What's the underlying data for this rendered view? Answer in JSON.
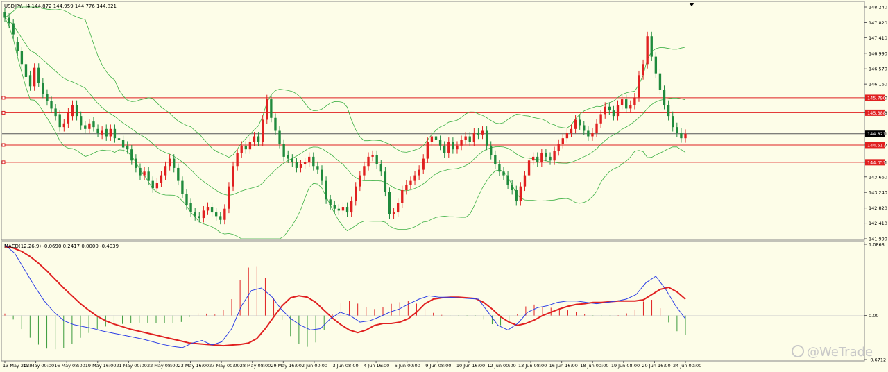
{
  "chart_data": [
    {
      "type": "candlestick",
      "title": "USDJPY,H4  144.872 144.959 144.776 144.821",
      "ylim": [
        141.99,
        148.24
      ],
      "y_ticks": [
        "148.240",
        "147.820",
        "147.410",
        "146.990",
        "146.570",
        "146.160",
        "145.790",
        "145.388",
        "144.821",
        "144.517",
        "144.051",
        "143.660",
        "143.240",
        "142.820",
        "142.410",
        "141.990"
      ],
      "current_price": "144.821",
      "horizontal_levels": [
        {
          "value": 145.79,
          "label": "145.790",
          "color": "#e02020"
        },
        {
          "value": 145.388,
          "label": "145.388",
          "color": "#e02020"
        },
        {
          "value": 144.517,
          "label": "144.517",
          "color": "#e02020"
        },
        {
          "value": 144.051,
          "label": "144.051",
          "color": "#e02020"
        }
      ],
      "indicators": [
        "Bollinger Bands"
      ],
      "colors": {
        "up": "#e02020",
        "down": "#1f8a3c",
        "bands": "#3cb043",
        "level": "#e02020",
        "price_line": "#555555"
      },
      "close": [
        147.95,
        147.8,
        147.5,
        147.05,
        146.7,
        146.35,
        146.1,
        146.6,
        146.2,
        145.9,
        145.7,
        145.5,
        145.3,
        145.0,
        145.1,
        145.4,
        145.6,
        145.3,
        145.05,
        144.95,
        145.1,
        145.0,
        144.85,
        144.9,
        144.75,
        144.95,
        144.7,
        144.65,
        144.45,
        144.4,
        144.1,
        143.9,
        143.7,
        143.8,
        143.55,
        143.35,
        143.5,
        143.7,
        143.95,
        144.15,
        143.9,
        143.55,
        143.2,
        142.9,
        142.7,
        142.6,
        142.55,
        142.75,
        142.85,
        142.7,
        142.6,
        142.5,
        142.8,
        143.4,
        143.95,
        144.3,
        144.5,
        144.4,
        144.6,
        144.75,
        144.6,
        145.2,
        145.75,
        145.25,
        144.9,
        144.55,
        144.2,
        144.15,
        144.05,
        143.9,
        144.0,
        144.05,
        144.2,
        143.95,
        143.85,
        143.55,
        143.05,
        142.9,
        142.8,
        142.75,
        142.85,
        142.7,
        143.0,
        143.4,
        143.7,
        143.95,
        144.2,
        144.25,
        144.0,
        143.8,
        143.25,
        142.65,
        142.7,
        142.95,
        143.3,
        143.45,
        143.55,
        143.7,
        143.85,
        144.15,
        144.6,
        144.75,
        144.65,
        144.5,
        144.3,
        144.6,
        144.4,
        144.5,
        144.65,
        144.75,
        144.6,
        144.85,
        144.8,
        144.9,
        144.5,
        144.25,
        144.0,
        143.8,
        143.7,
        143.45,
        143.3,
        143.0,
        143.4,
        143.7,
        144.1,
        144.2,
        144.05,
        144.3,
        144.2,
        144.1,
        144.35,
        144.55,
        144.7,
        144.85,
        144.95,
        145.2,
        145.05,
        144.9,
        144.75,
        144.85,
        145.1,
        145.35,
        145.55,
        145.45,
        145.3,
        145.6,
        145.75,
        145.5,
        145.6,
        145.8,
        146.4,
        146.7,
        147.45,
        146.9,
        146.45,
        146.0,
        145.6,
        145.3,
        145.0,
        144.85,
        144.7,
        144.82
      ],
      "open": [
        148.1,
        147.95,
        147.8,
        147.3,
        147.05,
        146.7,
        146.4,
        146.1,
        146.6,
        146.2,
        145.9,
        145.7,
        145.5,
        145.35,
        145.0,
        145.1,
        145.3,
        145.6,
        145.3,
        145.05,
        144.95,
        145.15,
        144.95,
        144.8,
        144.95,
        144.75,
        144.95,
        144.7,
        144.65,
        144.5,
        144.4,
        144.15,
        143.9,
        143.7,
        143.8,
        143.55,
        143.35,
        143.5,
        143.7,
        143.95,
        144.15,
        143.9,
        143.55,
        143.2,
        142.95,
        142.7,
        142.6,
        142.55,
        142.75,
        142.85,
        142.7,
        142.6,
        142.5,
        142.8,
        143.4,
        143.95,
        144.3,
        144.5,
        144.4,
        144.6,
        144.75,
        144.6,
        145.2,
        145.75,
        145.25,
        144.9,
        144.55,
        144.25,
        144.15,
        144.05,
        143.9,
        144.0,
        144.05,
        144.2,
        143.95,
        143.85,
        143.55,
        143.05,
        142.9,
        142.8,
        142.75,
        142.85,
        142.7,
        143.0,
        143.4,
        143.7,
        143.95,
        144.2,
        144.25,
        144.0,
        143.8,
        143.25,
        142.65,
        142.7,
        142.95,
        143.3,
        143.45,
        143.55,
        143.7,
        143.85,
        144.15,
        144.6,
        144.75,
        144.65,
        144.5,
        144.3,
        144.6,
        144.4,
        144.5,
        144.65,
        144.75,
        144.6,
        144.85,
        144.8,
        144.9,
        144.5,
        144.25,
        144.0,
        143.8,
        143.7,
        143.45,
        143.3,
        143.0,
        143.4,
        143.7,
        144.1,
        144.2,
        144.05,
        144.3,
        144.2,
        144.1,
        144.35,
        144.55,
        144.7,
        144.85,
        144.95,
        145.2,
        145.05,
        144.9,
        144.75,
        144.85,
        145.1,
        145.35,
        145.55,
        145.45,
        145.3,
        145.6,
        145.75,
        145.5,
        145.6,
        145.8,
        146.4,
        146.7,
        147.45,
        146.9,
        146.45,
        146.0,
        145.6,
        145.3,
        145.0,
        144.85,
        144.7
      ],
      "macd_panel": {
        "title": "MACD(12,26,9) -0.0690 0.2417 0.0000 -0.4039",
        "ylim": [
          -0.6712,
          1.0868
        ],
        "y_ticks": [
          "1.0868",
          "0.00",
          "-0.6712"
        ],
        "series": [
          {
            "name": "Signal",
            "color": "#e02020"
          },
          {
            "name": "MACD",
            "color": "#2c3ee6"
          }
        ],
        "histogram_colors": {
          "positive": "#e02020",
          "negative": "#3a9a3a"
        },
        "signal": [
          1.05,
          1.03,
          0.98,
          0.9,
          0.8,
          0.68,
          0.55,
          0.42,
          0.3,
          0.18,
          0.08,
          -0.01,
          -0.08,
          -0.13,
          -0.17,
          -0.21,
          -0.24,
          -0.27,
          -0.3,
          -0.33,
          -0.36,
          -0.39,
          -0.42,
          -0.43,
          -0.44,
          -0.45,
          -0.46,
          -0.45,
          -0.44,
          -0.42,
          -0.35,
          -0.2,
          -0.02,
          0.15,
          0.27,
          0.3,
          0.28,
          0.2,
          0.08,
          -0.04,
          -0.14,
          -0.22,
          -0.26,
          -0.22,
          -0.15,
          -0.12,
          -0.12,
          -0.1,
          -0.05,
          0.05,
          0.18,
          0.25,
          0.27,
          0.28,
          0.28,
          0.27,
          0.26,
          0.2,
          0.1,
          -0.02,
          -0.1,
          -0.15,
          -0.12,
          -0.07,
          0.0,
          0.05,
          0.1,
          0.14,
          0.17,
          0.18,
          0.2,
          0.2,
          0.21,
          0.22,
          0.22,
          0.22,
          0.24,
          0.32,
          0.4,
          0.43,
          0.36,
          0.25
        ],
        "macd": [
          1.08,
          0.95,
          0.7,
          0.45,
          0.22,
          0.05,
          -0.08,
          -0.14,
          -0.17,
          -0.2,
          -0.24,
          -0.27,
          -0.3,
          -0.33,
          -0.36,
          -0.4,
          -0.44,
          -0.47,
          -0.49,
          -0.42,
          -0.38,
          -0.45,
          -0.4,
          -0.2,
          0.15,
          0.38,
          0.42,
          0.3,
          0.1,
          -0.05,
          -0.15,
          -0.22,
          -0.2,
          -0.05,
          0.05,
          0.0,
          -0.1,
          -0.08,
          -0.02,
          0.05,
          0.1,
          0.18,
          0.25,
          0.3,
          0.28,
          0.28,
          0.27,
          0.26,
          0.25,
          0.05,
          -0.15,
          -0.22,
          -0.12,
          0.05,
          0.12,
          0.15,
          0.2,
          0.22,
          0.22,
          0.2,
          0.18,
          0.2,
          0.22,
          0.25,
          0.32,
          0.5,
          0.6,
          0.4,
          0.15,
          -0.05
        ]
      }
    }
  ],
  "x_axis_labels": [
    "13 May 2025",
    "15 May 00:00",
    "16 May 08:00",
    "19 May 16:00",
    "21 May 00:00",
    "22 May 08:00",
    "23 May 16:00",
    "27 May 00:00",
    "28 May 08:00",
    "29 May 16:00",
    "2 Jun 00:00",
    "3 Jun 08:00",
    "4 Jun 16:00",
    "6 Jun 00:00",
    "9 Jun 08:00",
    "10 Jun 16:00",
    "12 Jun 00:00",
    "13 Jun 08:00",
    "16 Jun 16:00",
    "18 Jun 00:00",
    "19 Jun 08:00",
    "20 Jun 16:00",
    "24 Jun 00:00"
  ],
  "watermark": "@WeTrade"
}
